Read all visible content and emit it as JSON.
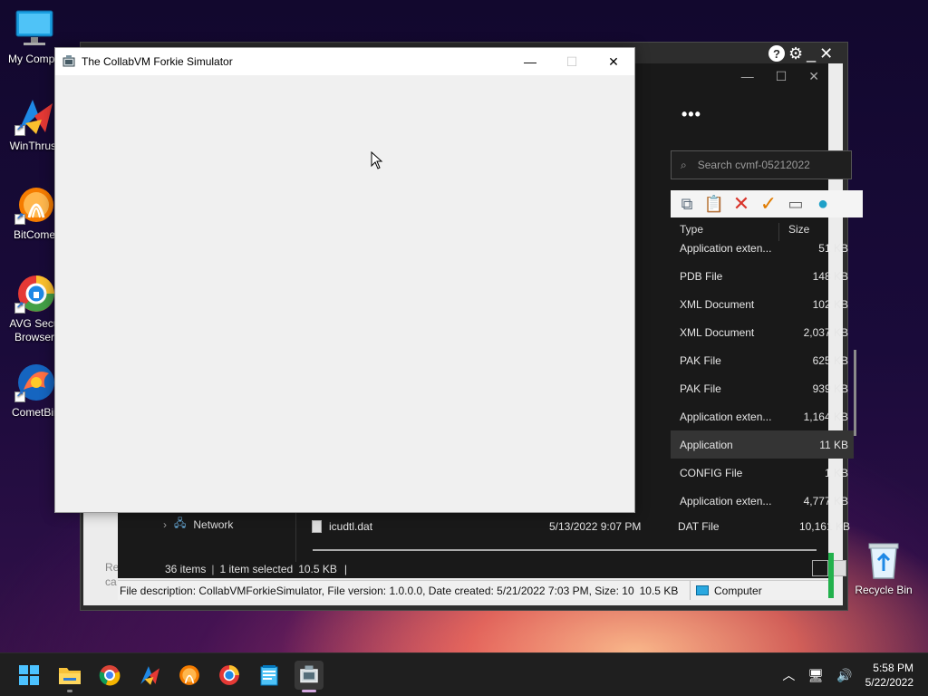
{
  "desktop": {
    "icons": [
      {
        "label": "My Compu",
        "icon": "computer-icon"
      },
      {
        "label": "WinThrust",
        "icon": "winthruster-icon"
      },
      {
        "label": "BitCome",
        "icon": "bitcomet-icon"
      },
      {
        "label": "AVG Secu",
        "label2": "Browser",
        "icon": "avg-browser-icon"
      },
      {
        "label": "CometBir",
        "icon": "cometbird-icon"
      }
    ],
    "recycle_bin": "Recycle Bin"
  },
  "forkie_window": {
    "title": "The CollabVM Forkie Simulator",
    "minimize": "—",
    "maximize": "☐",
    "close": "✕"
  },
  "explorer": {
    "more_label": "•••",
    "search_placeholder": "Search cvmf-05212022",
    "columns": {
      "type": "Type",
      "size": "Size"
    },
    "rows": [
      {
        "type": "Application exten...",
        "size": "51 KB"
      },
      {
        "type": "PDB File",
        "size": "148 KB"
      },
      {
        "type": "XML Document",
        "size": "102 KB"
      },
      {
        "type": "XML Document",
        "size": "2,037 KB"
      },
      {
        "type": "PAK File",
        "size": "625 KB"
      },
      {
        "type": "PAK File",
        "size": "939 KB"
      },
      {
        "type": "Application exten...",
        "size": "1,164 KB"
      },
      {
        "type": "Application",
        "size": "11 KB",
        "selected": true
      },
      {
        "type": "CONFIG File",
        "size": "1 KB"
      },
      {
        "type": "Application exten...",
        "size": "4,777 KB"
      }
    ],
    "nav_network": "Network",
    "file": {
      "name": "icudtl.dat",
      "date": "5/13/2022 9:07 PM",
      "type": "DAT File",
      "size": "10,161 KB"
    },
    "status": {
      "items": "36 items",
      "selected": "1 item selected",
      "selected_size": "10.5 KB",
      "trail": "|"
    },
    "left_fragment_1": "Re",
    "left_fragment_2": "ca",
    "description": "File description: CollabVMForkieSimulator, File version: 1.0.0.0, Date created: 5/21/2022 7:03 PM, Size: 10",
    "desc_size": "10.5 KB",
    "computer_label": "Computer"
  },
  "taskbar": {
    "apps": [
      "start-icon",
      "file-explorer-icon",
      "chrome-icon",
      "winthruster-icon",
      "bitcomet-icon",
      "avg-browser-icon",
      "notepad-icon",
      "forkie-simulator-icon"
    ],
    "time": "5:58 PM",
    "date": "5/22/2022"
  },
  "colors": {
    "accent_green": "#22b14c",
    "selection": "#343434",
    "titlebar": "#ffffff"
  }
}
